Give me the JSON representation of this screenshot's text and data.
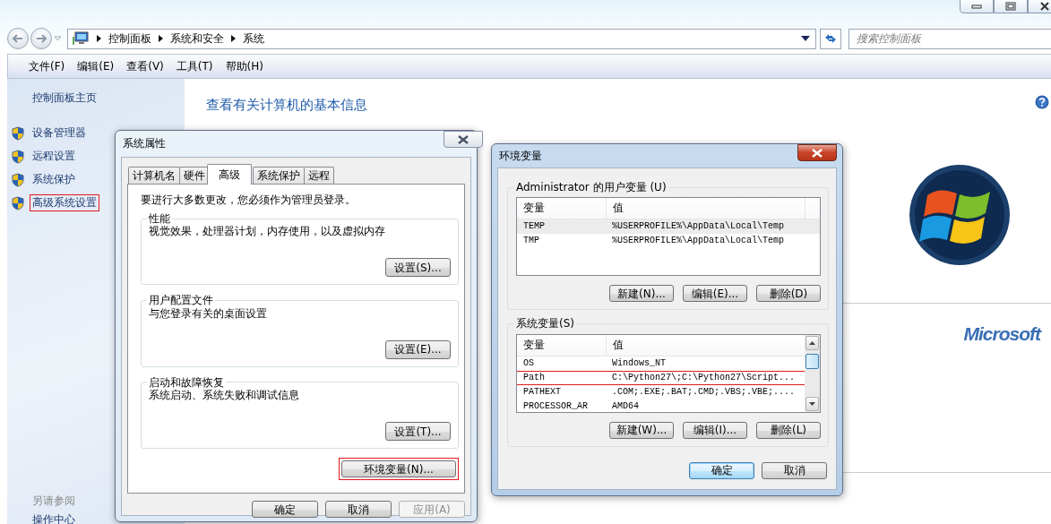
{
  "explorer": {
    "breadcrumb": [
      "控制面板",
      "系统和安全",
      "系统"
    ],
    "search": {
      "placeholder": "搜索控制面板"
    },
    "menu": [
      "文件(F)",
      "编辑(E)",
      "查看(V)",
      "工具(T)",
      "帮助(H)"
    ],
    "sidebar": {
      "home": "控制面板主页",
      "items": [
        {
          "label": "设备管理器",
          "highlighted": false
        },
        {
          "label": "远程设置",
          "highlighted": false
        },
        {
          "label": "系统保护",
          "highlighted": false
        },
        {
          "label": "高级系统设置",
          "highlighted": true
        }
      ],
      "see_also": {
        "heading": "另请参阅",
        "links": [
          "操作中心"
        ]
      }
    },
    "main": {
      "title": "查看有关计算机的基本信息",
      "logo_text": "Microsoft"
    }
  },
  "system_properties": {
    "title": "系统属性",
    "tabs": [
      {
        "label": "计算机名",
        "selected": false
      },
      {
        "label": "硬件",
        "selected": false
      },
      {
        "label": "高级",
        "selected": true
      },
      {
        "label": "系统保护",
        "selected": false
      },
      {
        "label": "远程",
        "selected": false
      }
    ],
    "notice": "要进行大多数更改，您必须作为管理员登录。",
    "groups": [
      {
        "title": "性能",
        "description": "视觉效果，处理器计划，内存使用，以及虚拟内存",
        "button": "设置(S)..."
      },
      {
        "title": "用户配置文件",
        "description": "与您登录有关的桌面设置",
        "button": "设置(E)..."
      },
      {
        "title": "启动和故障恢复",
        "description": "系统启动、系统失败和调试信息",
        "button": "设置(T)..."
      }
    ],
    "env_button": {
      "label": "环境变量(N)...",
      "highlighted": true
    },
    "buttons": [
      {
        "label": "确定",
        "disabled": false
      },
      {
        "label": "取消",
        "disabled": false
      },
      {
        "label": "应用(A)",
        "disabled": true
      }
    ]
  },
  "environment_variables": {
    "title": "环境变量",
    "sections": [
      {
        "title": "Administrator 的用户变量 (U)",
        "columns": [
          "变量",
          "值"
        ],
        "scrollable": false,
        "rows": [
          {
            "name": "TEMP",
            "value": "%USERPROFILE%\\AppData\\Local\\Temp",
            "selected": true,
            "highlighted": false
          },
          {
            "name": "TMP",
            "value": "%USERPROFILE%\\AppData\\Local\\Temp",
            "selected": false,
            "highlighted": false
          }
        ],
        "buttons": [
          "新建(N)...",
          "编辑(E)...",
          "删除(D)"
        ]
      },
      {
        "title": "系统变量(S)",
        "columns": [
          "变量",
          "值"
        ],
        "scrollable": true,
        "rows": [
          {
            "name": "OS",
            "value": "Windows_NT",
            "selected": false,
            "highlighted": false
          },
          {
            "name": "Path",
            "value": "C:\\Python27\\;C:\\Python27\\Script...",
            "selected": false,
            "highlighted": true
          },
          {
            "name": "PATHEXT",
            "value": ".COM;.EXE;.BAT;.CMD;.VBS;.VBE;....",
            "selected": false,
            "highlighted": false
          },
          {
            "name": "PROCESSOR_AR",
            "value": "AMD64",
            "selected": false,
            "highlighted": false
          }
        ],
        "buttons": [
          "新建(W)...",
          "编辑(I)...",
          "删除(L)"
        ]
      }
    ],
    "buttons": [
      {
        "label": "确定",
        "default": true
      },
      {
        "label": "取消",
        "default": false
      }
    ]
  }
}
